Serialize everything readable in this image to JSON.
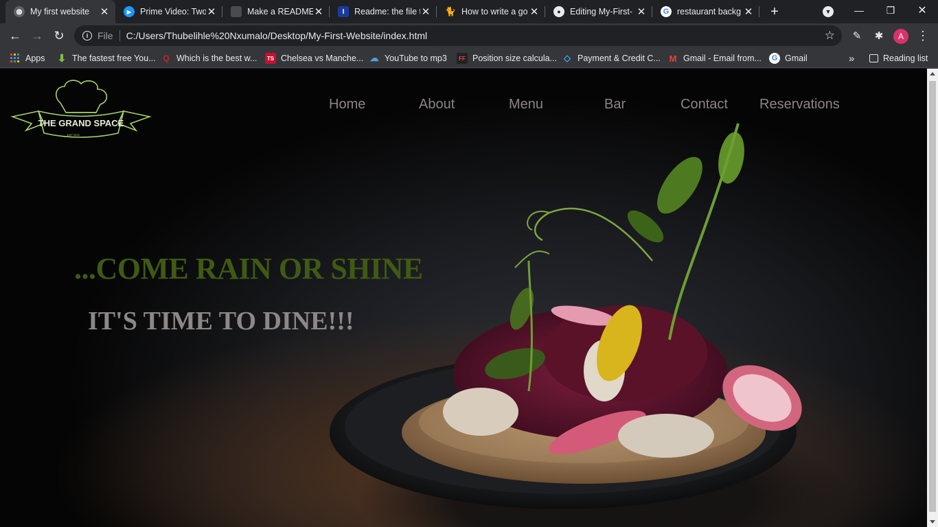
{
  "browser": {
    "tabs": [
      {
        "title": "My first website",
        "favicon": "globe-icon",
        "active": true
      },
      {
        "title": "Prime Video: Two",
        "favicon": "prime-video-icon",
        "active": false
      },
      {
        "title": "Make a README",
        "favicon": "document-icon",
        "active": false
      },
      {
        "title": "Readme: the file t",
        "favicon": "readme-icon",
        "active": false
      },
      {
        "title": "How to write a go",
        "favicon": "cat-icon",
        "active": false
      },
      {
        "title": "Editing My-First-",
        "favicon": "github-icon",
        "active": false
      },
      {
        "title": "restaurant backg",
        "favicon": "google-icon",
        "active": false
      }
    ],
    "address": {
      "scheme": "File",
      "url": "C:/Users/Thubelihle%20Nxumalo/Desktop/My-First-Website/index.html"
    },
    "profile_initial": "A",
    "bookmarks": [
      {
        "label": "Apps",
        "icon": "apps-grid-icon"
      },
      {
        "label": "The fastest free You...",
        "icon": "download-arrow-icon"
      },
      {
        "label": "Which is the best w...",
        "icon": "quora-icon"
      },
      {
        "label": "Chelsea vs Manche...",
        "icon": "ts-icon"
      },
      {
        "label": "YouTube to mp3",
        "icon": "cloud-download-icon"
      },
      {
        "label": "Position size calcula...",
        "icon": "ff-icon"
      },
      {
        "label": "Payment & Credit C...",
        "icon": "diamond-icon"
      },
      {
        "label": "Gmail - Email from...",
        "icon": "gmail-icon"
      },
      {
        "label": "Gmail",
        "icon": "google-icon"
      }
    ],
    "reading_list": "Reading list",
    "overflow": "»"
  },
  "site": {
    "logo": {
      "text": "THE GRAND SPACE",
      "subtext": "EST 2015"
    },
    "nav": [
      "Home",
      "About",
      "Menu",
      "Bar",
      "Contact",
      "Reservations"
    ],
    "headline": "...COME RAIN OR SHINE",
    "subheadline": "IT'S TIME TO DINE!!!"
  },
  "colors": {
    "headline": "#3f5a14",
    "subheadline": "#8d8787",
    "nav": "#8b8585",
    "logo": "#a7d46b"
  }
}
